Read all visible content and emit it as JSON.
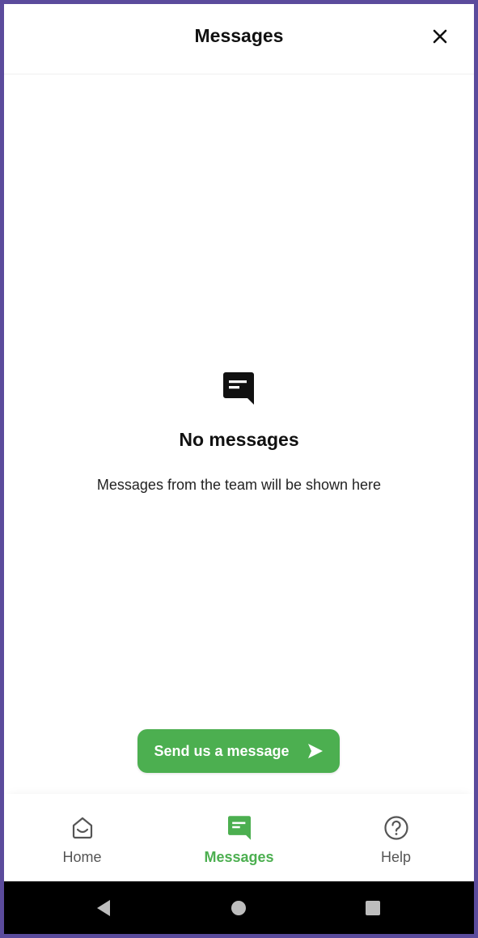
{
  "header": {
    "title": "Messages"
  },
  "empty_state": {
    "title": "No messages",
    "subtitle": "Messages from the team will be shown here"
  },
  "send_button": {
    "label": "Send us a message"
  },
  "tabs": [
    {
      "label": "Home",
      "icon": "home-icon",
      "active": false
    },
    {
      "label": "Messages",
      "icon": "messages-icon",
      "active": true
    },
    {
      "label": "Help",
      "icon": "help-icon",
      "active": false
    }
  ],
  "colors": {
    "accent": "#4caf50",
    "frame": "#5b4b9c",
    "navbar": "#000000"
  },
  "system_nav": [
    "back-icon",
    "home-circle-icon",
    "recents-icon"
  ]
}
